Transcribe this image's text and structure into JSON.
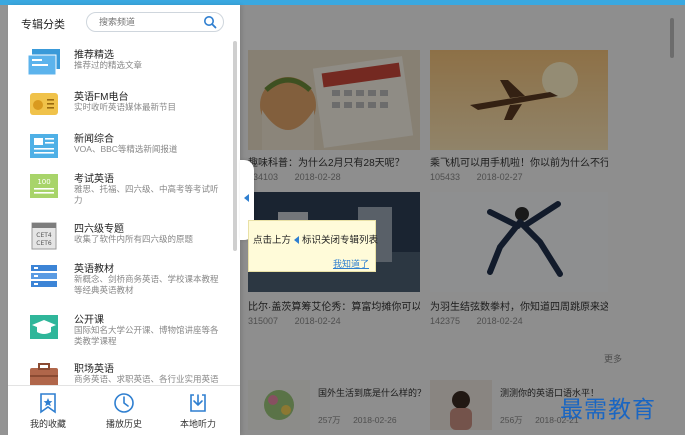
{
  "sidebar": {
    "title": "专辑分类",
    "search_placeholder": "搜索频道",
    "items": [
      {
        "name": "推荐精选",
        "desc": "推荐过的精选文章"
      },
      {
        "name": "英语FM电台",
        "desc": "实时收听英语媒体最新节目"
      },
      {
        "name": "新闻综合",
        "desc": "VOA、BBC等精选新闻报道"
      },
      {
        "name": "考试英语",
        "desc": "雅思、托福、四六级、中高考等考试听力"
      },
      {
        "name": "四六级专题",
        "desc": "收集了软件内所有四六级的原题"
      },
      {
        "name": "英语教材",
        "desc": "新概念、剑桥商务英语、学校课本教程等经典英语教材"
      },
      {
        "name": "公开课",
        "desc": "国际知名大学公开课、博物馆讲座等各类教学课程"
      },
      {
        "name": "职场英语",
        "desc": "商务英语、求职英语、各行业实用英语"
      }
    ],
    "footer": [
      {
        "label": "我的收藏"
      },
      {
        "label": "播放历史"
      },
      {
        "label": "本地听力"
      }
    ]
  },
  "cards": [
    {
      "title": "趣味科普：为什么2月只有28天呢？",
      "plays": "134103",
      "date": "2018-02-28"
    },
    {
      "title": "乘飞机可以用手机啦！你以前为什么不行…",
      "plays": "105433",
      "date": "2018-02-27"
    },
    {
      "title": "比尔·盖茨算筹艾伦秀：算富均摊你可以吗？",
      "plays": "315007",
      "date": "2018-02-24"
    },
    {
      "title": "为羽生结弦数拳村，你知道四周跳原来这么…",
      "plays": "142375",
      "date": "2018-02-24"
    }
  ],
  "bottom": [
    {
      "title": "国外生活到底是什么样的？",
      "plays": "257万",
      "date": "2018-02-26"
    },
    {
      "title": "测测你的英语口语水平！",
      "plays": "256万",
      "date": "2018-02-21"
    }
  ],
  "more_label": "更多",
  "tooltip": {
    "text_before": "点击上方",
    "text_after": "标识关闭专辑列表",
    "link": "我知道了"
  },
  "watermark": "最需教育"
}
